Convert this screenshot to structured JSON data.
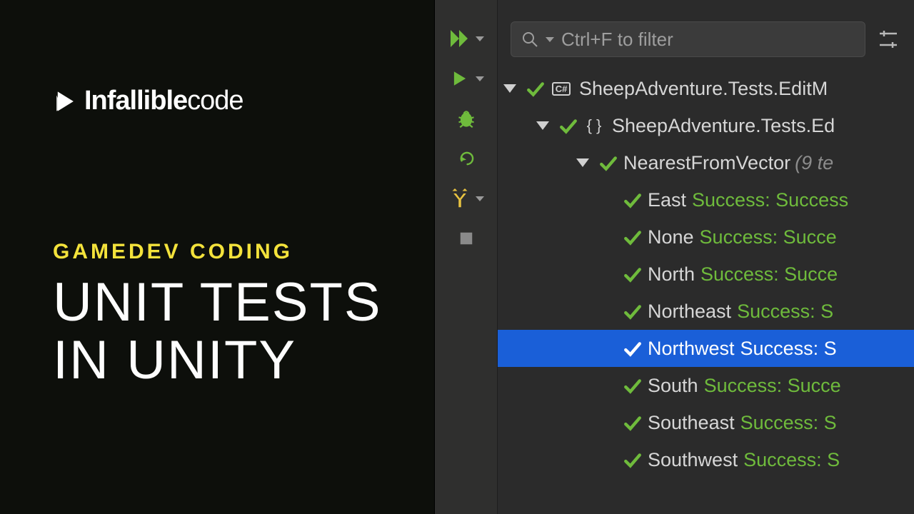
{
  "brand": {
    "bold": "Infallible",
    "thin": "code"
  },
  "subtitle": "GAMEDEV CODING",
  "title_line1": "UNIT TESTS",
  "title_line2": "IN UNITY",
  "search": {
    "placeholder": "Ctrl+F to filter"
  },
  "tree": {
    "assembly": "SheepAdventure.Tests.EditM",
    "namespace": "SheepAdventure.Tests.Ed",
    "fixture": "NearestFromVector",
    "fixture_meta": "(9 te",
    "tests": [
      {
        "name": "East",
        "status": "Success: Success",
        "selected": false
      },
      {
        "name": "None",
        "status": "Success: Succe",
        "selected": false
      },
      {
        "name": "North",
        "status": "Success: Succe",
        "selected": false
      },
      {
        "name": "Northeast",
        "status": "Success: S",
        "selected": false
      },
      {
        "name": "Northwest",
        "status": "Success: S",
        "selected": true
      },
      {
        "name": "South",
        "status": "Success: Succe",
        "selected": false
      },
      {
        "name": "Southeast",
        "status": "Success: S",
        "selected": false
      },
      {
        "name": "Southwest",
        "status": "Success: S",
        "selected": false
      }
    ]
  },
  "colors": {
    "green": "#6fbb3c",
    "blueSelect": "#1a5fd8",
    "yellow": "#f3e23b"
  }
}
